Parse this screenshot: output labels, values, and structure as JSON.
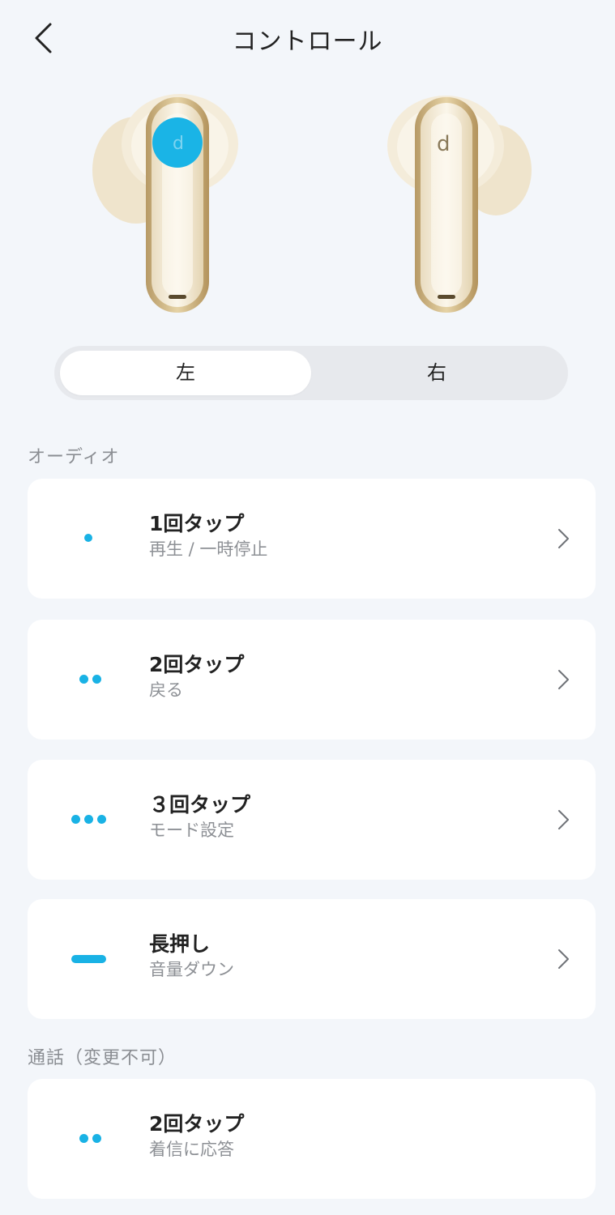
{
  "header": {
    "title": "コントロール",
    "back_icon": "chevron-left-icon"
  },
  "earbuds": {
    "left_image": "left-earbud-image",
    "right_image": "right-earbud-image",
    "highlight_color": "#1ab4e6",
    "body_color": "#f3ebd8",
    "trim_color": "#cbb186"
  },
  "segment": {
    "left_label": "左",
    "right_label": "右",
    "selected": "左"
  },
  "audio_section": {
    "title": "オーディオ",
    "items": [
      {
        "label": "1回タップ",
        "value": "再生 / 一時停止",
        "indicator": "single-dot-icon"
      },
      {
        "label": "2回タップ",
        "value": "戻る",
        "indicator": "double-dot-icon"
      },
      {
        "label": "３回タップ",
        "value": "モード設定",
        "indicator": "triple-dot-icon"
      },
      {
        "label": "長押し",
        "value": "音量ダウン",
        "indicator": "long-press-dash-icon"
      }
    ]
  },
  "call_section": {
    "title": "通話（変更不可）",
    "items": [
      {
        "label": "2回タップ",
        "value": "着信に応答",
        "indicator": "double-dot-icon"
      }
    ]
  },
  "colors": {
    "accent": "#19b2e5",
    "background": "#f3f6fa",
    "card": "#ffffff",
    "muted_text": "#8d9095"
  }
}
